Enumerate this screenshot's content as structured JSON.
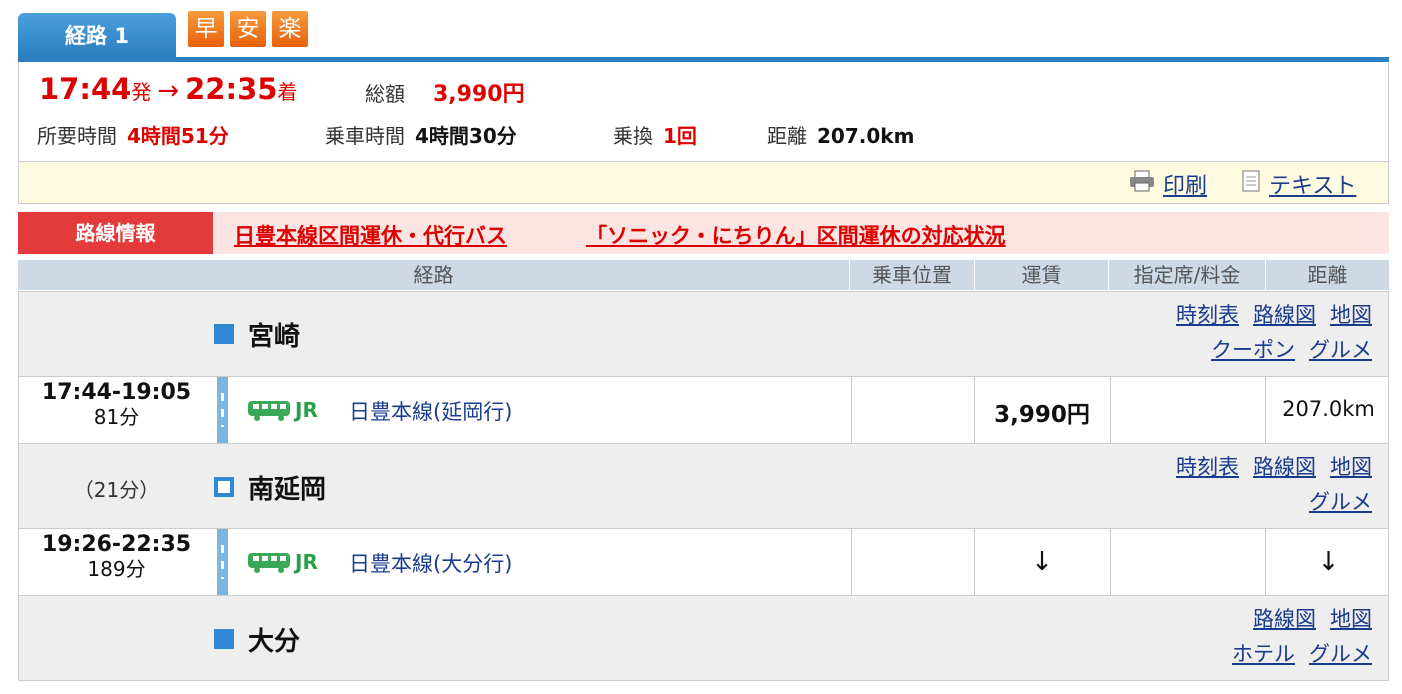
{
  "tabs": {
    "route_tab": "経路 1",
    "badges": [
      "早",
      "安",
      "楽"
    ]
  },
  "summary": {
    "depart_time": "17:44",
    "depart_suffix": "発",
    "arrow": "→",
    "arrive_time": "22:35",
    "arrive_suffix": "着",
    "fare_label": "総額",
    "fare_value": "3,990円",
    "total_time_label": "所要時間",
    "total_time_value": "4時間51分",
    "ride_time_label": "乗車時間",
    "ride_time_value": "4時間30分",
    "transfer_label": "乗換",
    "transfer_value": "1回",
    "distance_label": "距離",
    "distance_value": "207.0km"
  },
  "tools": {
    "print": "印刷",
    "text": "テキスト"
  },
  "line_info": {
    "label": "路線情報",
    "links": [
      "日豊本線区間運休・代行バス",
      "「ソニック・にちりん」区間運休の対応状況"
    ]
  },
  "table_header": [
    "経路",
    "乗車位置",
    "運賃",
    "指定席/料金",
    "距離"
  ],
  "stations": [
    {
      "name": "宮崎",
      "links_row1": [
        "時刻表",
        "路線図",
        "地図"
      ],
      "links_row2": [
        "クーポン",
        "グルメ"
      ]
    },
    {
      "name": "南延岡",
      "wait": "（21分）",
      "links_row1": [
        "時刻表",
        "路線図",
        "地図"
      ],
      "links_row2": [
        "グルメ"
      ]
    },
    {
      "name": "大分",
      "links_row1": [
        "路線図",
        "地図"
      ],
      "links_row2": [
        "ホテル",
        "グルメ"
      ]
    }
  ],
  "segments": [
    {
      "time": "17:44-19:05",
      "duration": "81分",
      "company": "JR",
      "line": "日豊本線(延岡行)",
      "fare": "3,990円",
      "distance": "207.0km"
    },
    {
      "time": "19:26-22:35",
      "duration": "189分",
      "company": "JR",
      "line": "日豊本線(大分行)",
      "fare_arrow": "↓",
      "distance_arrow": "↓"
    }
  ],
  "colors": {
    "accent_blue": "#2c7fc0",
    "red": "#dd0000",
    "badge_orange": "#e8620c",
    "jr_green": "#2a9d4a"
  }
}
